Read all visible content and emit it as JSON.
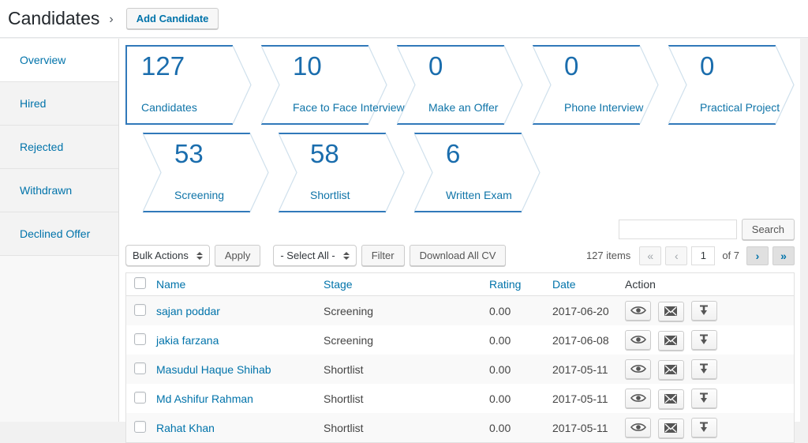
{
  "header": {
    "title": "Candidates",
    "separator": "›",
    "add_button": "Add Candidate"
  },
  "sidebar": {
    "items": [
      {
        "label": "Overview",
        "active": true
      },
      {
        "label": "Hired",
        "active": false
      },
      {
        "label": "Rejected",
        "active": false
      },
      {
        "label": "Withdrawn",
        "active": false
      },
      {
        "label": "Declined Offer",
        "active": false
      }
    ]
  },
  "stages": {
    "row1": [
      {
        "count": "127",
        "label": "Candidates"
      },
      {
        "count": "10",
        "label": "Face to Face Interview"
      },
      {
        "count": "0",
        "label": "Make an Offer"
      },
      {
        "count": "0",
        "label": "Phone Interview"
      },
      {
        "count": "0",
        "label": "Practical Project"
      }
    ],
    "row2": [
      {
        "count": "53",
        "label": "Screening"
      },
      {
        "count": "58",
        "label": "Shortlist"
      },
      {
        "count": "6",
        "label": "Written Exam"
      }
    ]
  },
  "toolbar": {
    "bulk_actions": "Bulk Actions",
    "apply": "Apply",
    "select_all": "- Select All -",
    "filter": "Filter",
    "download_all": "Download All CV",
    "search_value": "",
    "search_button": "Search"
  },
  "pagination": {
    "items_count": "127 items",
    "first": "«",
    "prev": "‹",
    "current_page": "1",
    "of_label": "of 7",
    "next": "›",
    "last": "»"
  },
  "table": {
    "headers": {
      "name": "Name",
      "stage": "Stage",
      "rating": "Rating",
      "date": "Date",
      "action": "Action"
    },
    "rows": [
      {
        "name": "sajan poddar",
        "stage": "Screening",
        "rating": "0.00",
        "date": "2017-06-20"
      },
      {
        "name": "jakia farzana",
        "stage": "Screening",
        "rating": "0.00",
        "date": "2017-06-08"
      },
      {
        "name": "Masudul Haque Shihab",
        "stage": "Shortlist",
        "rating": "0.00",
        "date": "2017-05-11"
      },
      {
        "name": "Md Ashifur Rahman",
        "stage": "Shortlist",
        "rating": "0.00",
        "date": "2017-05-11"
      },
      {
        "name": "Rahat Khan",
        "stage": "Shortlist",
        "rating": "0.00",
        "date": "2017-05-11"
      }
    ]
  },
  "icons": {
    "view": "eye-icon",
    "email": "envelope-icon",
    "download": "download-icon"
  },
  "colors": {
    "link_blue": "#0073aa",
    "stage_number_blue": "#1a6dad",
    "stage_border_strong": "#3179ba",
    "stage_border_pale": "#cfe0ec",
    "page_background": "#f1f1f1",
    "stripe_row": "#f9f9f9"
  }
}
